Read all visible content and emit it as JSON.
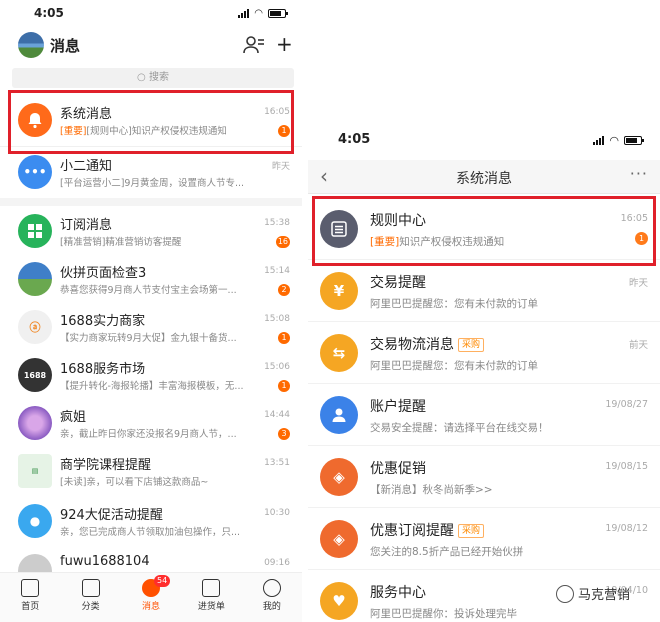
{
  "left": {
    "status_time": "4:05",
    "header_title": "消息",
    "search_placeholder": "搜索",
    "rows": [
      {
        "name": "系统消息",
        "tag": "[重要]",
        "preview": "[规则中心]知识产权侵权违规通知",
        "time": "16:05",
        "badge": "1",
        "icon": "bell-icon",
        "color": "#ff6a1a"
      },
      {
        "name": "小二通知",
        "tag": "",
        "preview": "[平台运营小二]9月黄金周，设置商人节专...",
        "time": "昨天",
        "badge": "",
        "icon": "chat-icon",
        "color": "#3b8cf0"
      },
      {
        "name": "订阅消息",
        "tag": "",
        "preview": "[精准营销]精准营销访客提醒",
        "time": "15:38",
        "badge": "16",
        "icon": "grid-icon",
        "color": "#27b35b"
      },
      {
        "name": "伙拼页面检查3",
        "tag": "",
        "preview": "恭喜您获得9月商人节支付宝主会场第一...",
        "time": "15:14",
        "badge": "2",
        "icon": "landscape-avatar",
        "color": "#5aa0dc"
      },
      {
        "name": "1688实力商家",
        "tag": "",
        "preview": "【实力商家玩转9月大促】金九银十备货...",
        "time": "15:08",
        "badge": "1",
        "icon": "alibaba-logo",
        "color": "#e8e8e8"
      },
      {
        "name": "1688服务市场",
        "tag": "",
        "preview": "【提升转化-海报轮播】丰富海报模板，无...",
        "time": "15:06",
        "badge": "1",
        "icon": "1688-logo",
        "color": "#333333"
      },
      {
        "name": "疯姐",
        "tag": "",
        "preview": "亲，截止昨日你家还没报名9月商人节，...",
        "time": "14:44",
        "badge": "3",
        "icon": "flower-avatar",
        "color": "#8a5bc2"
      },
      {
        "name": "商学院课程提醒",
        "tag": "",
        "preview": "[未读]亲，可以看下店铺这款商品~",
        "time": "13:51",
        "badge": "",
        "icon": "course-logo",
        "color": "#e6f3e6"
      },
      {
        "name": "924大促活动提醒",
        "tag": "",
        "preview": "亲，您已完成商人节领取加油包操作，只...",
        "time": "10:30",
        "badge": "",
        "icon": "chat-bubble-icon",
        "color": "#3aa8ef"
      },
      {
        "name": "fuwu1688104",
        "tag": "",
        "preview": "",
        "time": "09:16",
        "badge": "",
        "icon": "user-avatar",
        "color": "#cccccc"
      }
    ],
    "tabs": [
      {
        "label": "首页",
        "icon": "home-icon"
      },
      {
        "label": "分类",
        "icon": "category-icon"
      },
      {
        "label": "消息",
        "icon": "message-icon",
        "badge": "54"
      },
      {
        "label": "进货单",
        "icon": "order-list-icon"
      },
      {
        "label": "我的",
        "icon": "profile-icon"
      }
    ]
  },
  "right": {
    "status_time": "4:05",
    "nav_title": "系统消息",
    "nav_more": "···",
    "rows": [
      {
        "name": "规则中心",
        "tag": "",
        "prefix": "[重要]",
        "preview": "知识产权侵权违规通知",
        "time": "16:05",
        "badge": "1",
        "icon": "list-icon",
        "color": "#5a5d6e"
      },
      {
        "name": "交易提醒",
        "tag": "",
        "prefix": "",
        "preview": "阿里巴巴提醒您：您有未付款的订单",
        "time": "昨天",
        "badge": "",
        "icon": "yen-icon",
        "color": "#f5a623"
      },
      {
        "name": "交易物流消息",
        "tag": "采购",
        "prefix": "",
        "preview": "阿里巴巴提醒您：您有未付款的订单",
        "time": "前天",
        "badge": "",
        "icon": "exchange-icon",
        "color": "#f5a623"
      },
      {
        "name": "账户提醒",
        "tag": "",
        "prefix": "",
        "preview": "交易安全提醒：请选择平台在线交易！",
        "time": "19/08/27",
        "badge": "",
        "icon": "person-icon",
        "color": "#3b82e8"
      },
      {
        "name": "优惠促销",
        "tag": "",
        "prefix": "",
        "preview": "【新消息】秋冬尚新季>>",
        "time": "19/08/15",
        "badge": "",
        "icon": "price-tag-icon",
        "color": "#ef6a2e"
      },
      {
        "name": "优惠订阅提醒",
        "tag": "采购",
        "prefix": "",
        "preview": "您关注的8.5折产品已经开始伙拼",
        "time": "19/08/12",
        "badge": "",
        "icon": "price-tag-icon",
        "color": "#ef6a2e"
      },
      {
        "name": "服务中心",
        "tag": "",
        "prefix": "",
        "preview": "阿里巴巴提醒你：投诉处理完毕",
        "time": "19/04/10",
        "badge": "",
        "icon": "heart-icon",
        "color": "#f5a623"
      }
    ]
  },
  "watermark": "马克营销"
}
